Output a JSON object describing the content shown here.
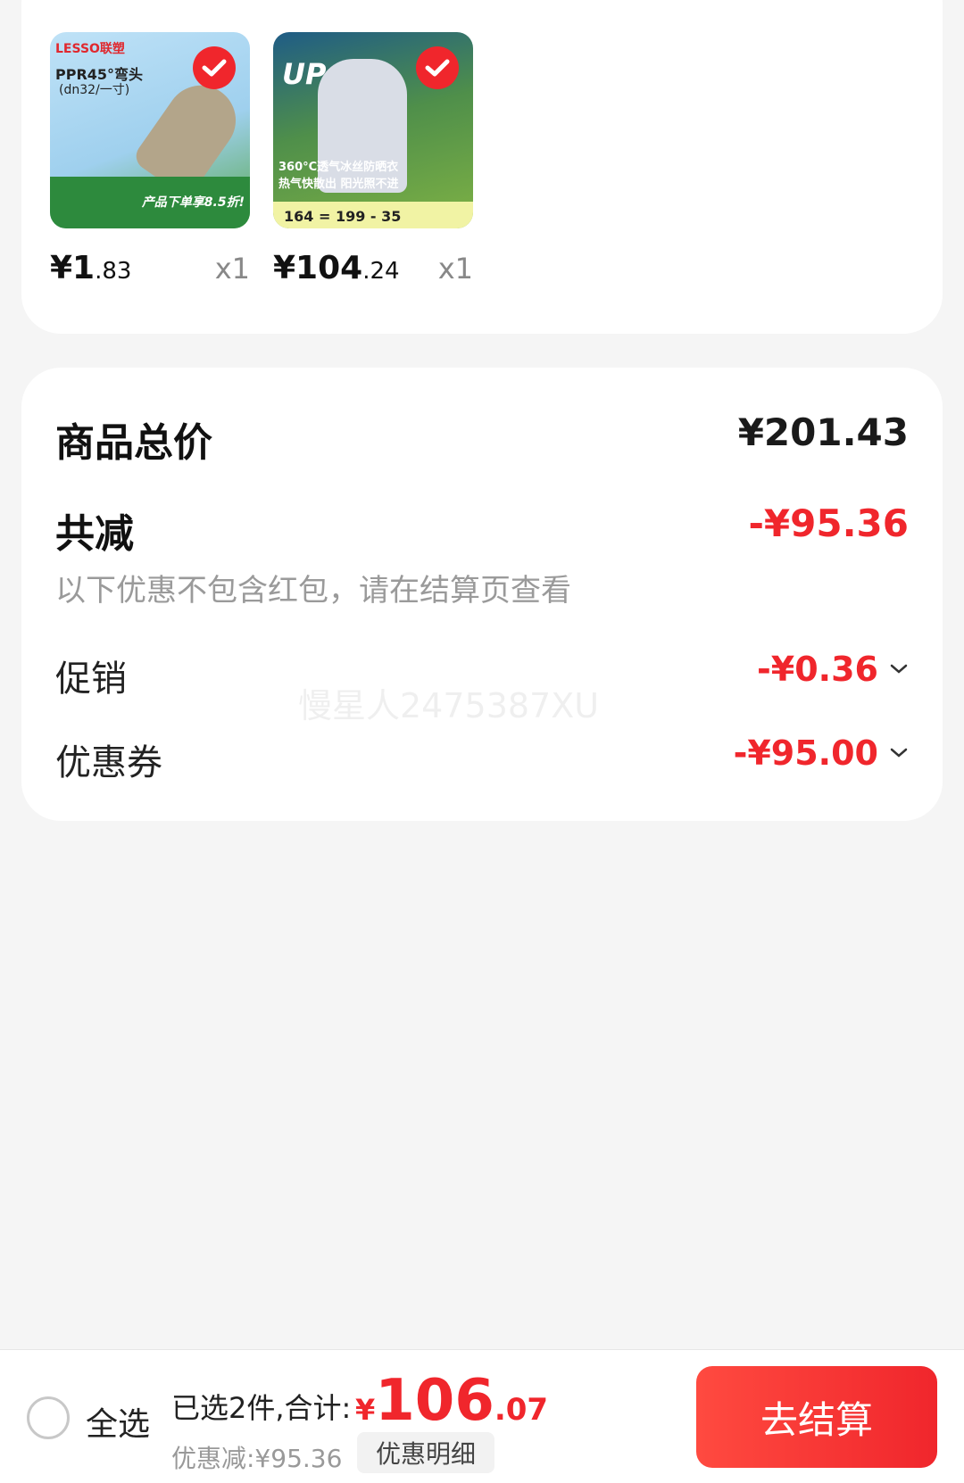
{
  "products": [
    {
      "thumb_brand": "LESSO联塑",
      "thumb_line1": "PPR45°弯头",
      "thumb_line2": "(dn32/一寸)",
      "thumb_tag": "产品下单享8.5折!",
      "price_int": "¥1",
      "price_dec": ".83",
      "qty": "x1",
      "selected": true
    },
    {
      "thumb_big": "UP",
      "thumb_caption": "360°C透气冰丝防晒衣 热气快散出 阳光照不进",
      "thumb_strip": "164 = 199 - 35",
      "price_int": "¥104",
      "price_dec": ".24",
      "qty": "x1",
      "selected": true
    }
  ],
  "summary": {
    "total_label": "商品总价",
    "total_value": "¥201.43",
    "reduce_label": "共减",
    "reduce_value": "-¥95.36",
    "reduce_note": "以下优惠不包含红包，请在结算页查看",
    "promo_label": "促销",
    "promo_value": "-¥0.36",
    "coupon_label": "优惠券",
    "coupon_value": "-¥95.00"
  },
  "watermark": "慢星人2475387XU",
  "bottom": {
    "select_all": "全选",
    "chosen_text": "已选2件,合计:",
    "currency": "¥",
    "total_int": "106",
    "total_dec": ".07",
    "discount_text": "优惠减:¥95.36",
    "detail_btn": "优惠明细",
    "checkout_btn": "去结算"
  },
  "colors": {
    "accent": "#f0262c",
    "background": "#f5f5f5"
  }
}
